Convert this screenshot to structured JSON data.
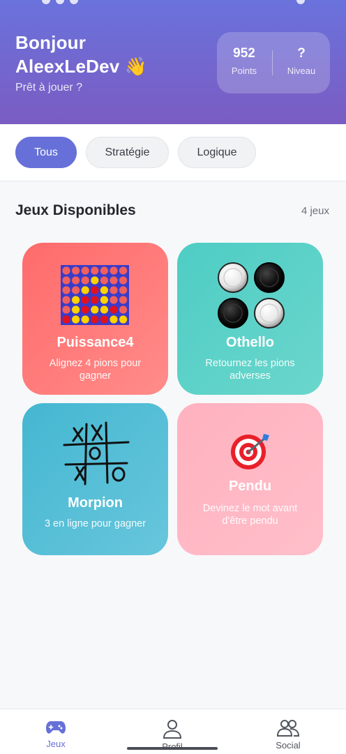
{
  "header": {
    "greeting_line1": "Bonjour",
    "greeting_line2": "AleexLeDev",
    "wave_emoji": "👋",
    "subtitle": "Prêt à jouer ?",
    "stats": [
      {
        "value": "952",
        "label": "Points"
      },
      {
        "value": "?",
        "label": "Niveau"
      }
    ]
  },
  "filters": [
    {
      "label": "Tous",
      "active": true
    },
    {
      "label": "Stratégie",
      "active": false
    },
    {
      "label": "Logique",
      "active": false
    }
  ],
  "section": {
    "title": "Jeux Disponibles",
    "count": "4 jeux"
  },
  "games": [
    {
      "name": "Puissance4",
      "description": "Alignez 4 pions pour gagner",
      "color": "#fe7472",
      "icon": "connect-four-icon"
    },
    {
      "name": "Othello",
      "description": "Retournez les pions adverses",
      "color": "#5ed0c5",
      "icon": "othello-discs-icon"
    },
    {
      "name": "Morpion",
      "description": "3 en ligne pour gagner",
      "color": "#4fb8d5",
      "icon": "tic-tac-toe-icon"
    },
    {
      "name": "Pendu",
      "description": "Devinez le mot avant d'être pendu",
      "color": "#ffb2c0",
      "icon": "target-dart-icon"
    }
  ],
  "nav": [
    {
      "label": "Jeux",
      "icon": "gamepad-icon",
      "active": true
    },
    {
      "label": "Profil",
      "icon": "user-icon",
      "active": false
    },
    {
      "label": "Social",
      "icon": "users-icon",
      "active": false
    }
  ],
  "colors": {
    "accent": "#6670d8",
    "header_gradient_start": "#6a72dc",
    "header_gradient_end": "#7a5cc2"
  }
}
